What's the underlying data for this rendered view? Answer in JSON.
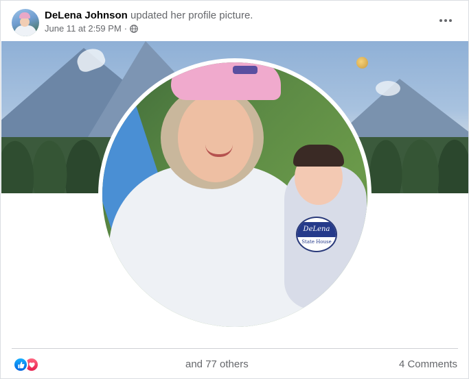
{
  "post": {
    "author": "DeLena Johnson",
    "action": "updated her profile picture.",
    "date": "June 11 at 2:59 PM",
    "separator": "·",
    "privacy_icon": "globe-icon",
    "menu_icon": "more-options-icon"
  },
  "photo": {
    "badge_name": "DeLena",
    "badge_sub": "State House"
  },
  "footer": {
    "reaction_icons": [
      "like-reaction-icon",
      "love-reaction-icon"
    ],
    "reactions_text": "and 77 others",
    "comments_text": "4 Comments"
  },
  "colors": {
    "like": "#1877f2",
    "love": "#f33e58",
    "secondary_text": "#65676b"
  }
}
